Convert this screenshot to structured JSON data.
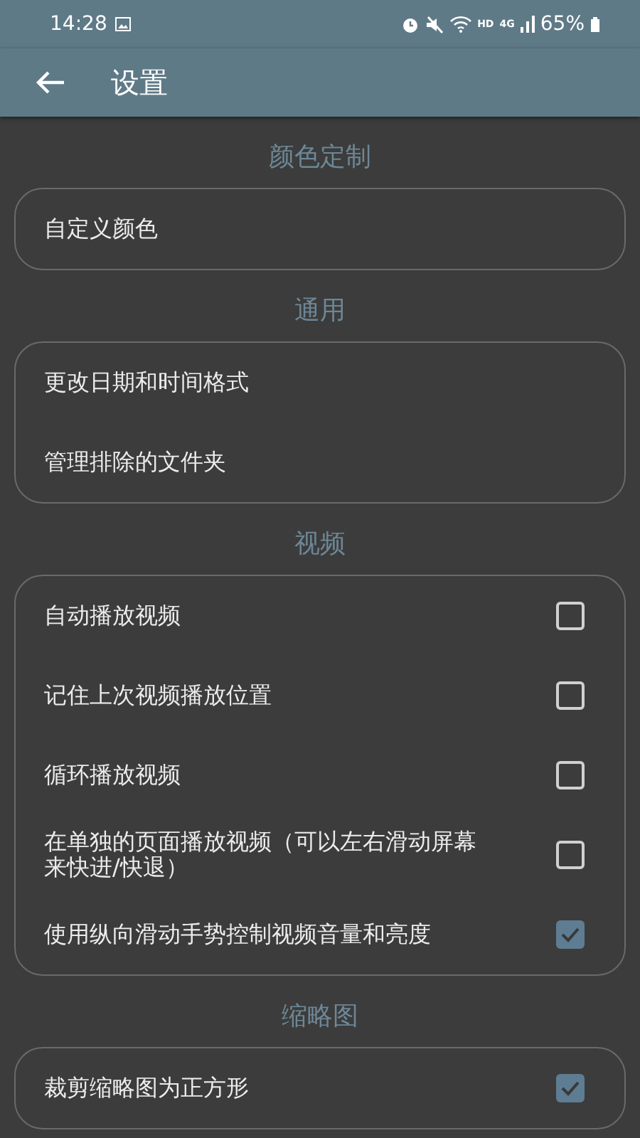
{
  "status_bar": {
    "time": "14:28",
    "network_hd": "HD",
    "network_type": "4G",
    "battery": "65%"
  },
  "app_bar": {
    "title": "设置"
  },
  "sections": [
    {
      "title": "颜色定制",
      "items": [
        {
          "kind": "link",
          "label": "自定义颜色"
        }
      ]
    },
    {
      "title": "通用",
      "items": [
        {
          "kind": "link",
          "label": "更改日期和时间格式"
        },
        {
          "kind": "link",
          "label": "管理排除的文件夹"
        }
      ]
    },
    {
      "title": "视频",
      "items": [
        {
          "kind": "checkbox",
          "label": "自动播放视频",
          "checked": false
        },
        {
          "kind": "checkbox",
          "label": "记住上次视频播放位置",
          "checked": false
        },
        {
          "kind": "checkbox",
          "label": "循环播放视频",
          "checked": false
        },
        {
          "kind": "checkbox",
          "label": "在单独的页面播放视频（可以左右滑动屏幕来快进/快退）",
          "checked": false
        },
        {
          "kind": "checkbox",
          "label": "使用纵向滑动手势控制视频音量和亮度",
          "checked": true
        }
      ]
    },
    {
      "title": "缩略图",
      "items": [
        {
          "kind": "checkbox",
          "label": "裁剪缩略图为正方形",
          "checked": true
        }
      ]
    }
  ]
}
